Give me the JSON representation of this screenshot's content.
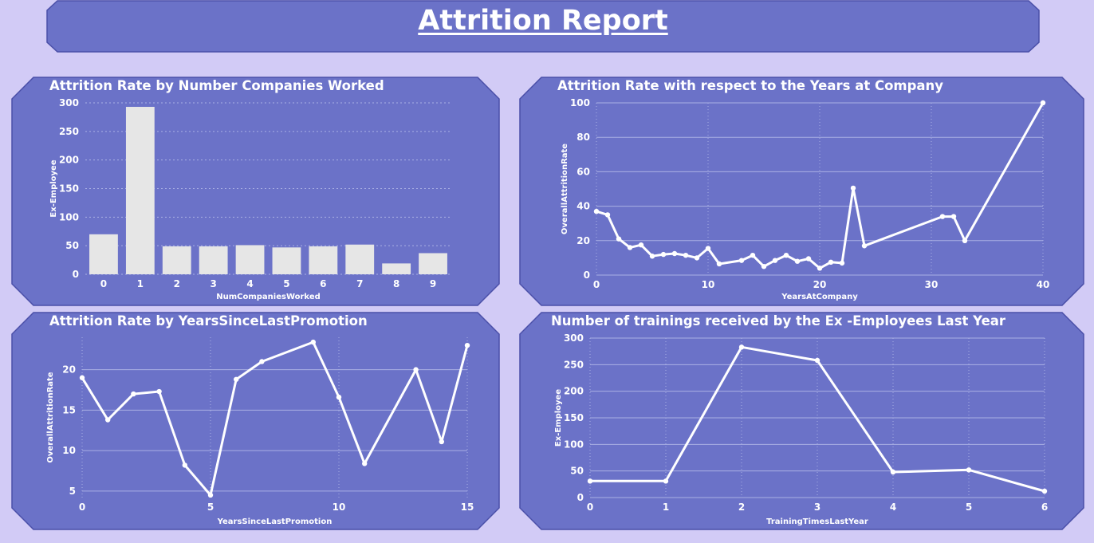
{
  "report": {
    "title": "Attrition Report"
  },
  "colors": {
    "background": "#d2cbf6",
    "panel": "#6b72c8",
    "panel_border": "#4a4fa8",
    "bar": "#e6e6e6",
    "line": "#ffffff",
    "grid": "#aab0e4"
  },
  "chart_data": [
    {
      "type": "bar",
      "title": "Attrition Rate by Number Companies Worked",
      "xlabel": "NumCompaniesWorked",
      "ylabel": "Ex-Employee",
      "categories": [
        "0",
        "1",
        "2",
        "3",
        "4",
        "5",
        "6",
        "7",
        "8",
        "9"
      ],
      "values": [
        70,
        293,
        49,
        49,
        51,
        47,
        49,
        52,
        19,
        37
      ],
      "ylim": [
        0,
        300
      ],
      "yticks": [
        0,
        50,
        100,
        150,
        200,
        250,
        300
      ],
      "grid": true
    },
    {
      "type": "line",
      "title": "Attrition Rate with respect to the Years at Company",
      "xlabel": "YearsAtCompany",
      "ylabel": "OverallAttritionRate",
      "x": [
        0,
        1,
        2,
        3,
        4,
        5,
        6,
        7,
        8,
        9,
        10,
        11,
        13,
        14,
        15,
        16,
        17,
        18,
        19,
        20,
        21,
        22,
        23,
        24,
        31,
        32,
        33,
        40
      ],
      "y": [
        37,
        35,
        21,
        16,
        17.5,
        11,
        12,
        12.5,
        11.5,
        10,
        15.5,
        6.5,
        8.5,
        11.5,
        5,
        8.5,
        11.5,
        8,
        9.5,
        4,
        7.5,
        7,
        50.5,
        17,
        34,
        34,
        20,
        100
      ],
      "xlim": [
        0,
        40
      ],
      "ylim": [
        0,
        100
      ],
      "xticks": [
        0,
        10,
        20,
        30,
        40
      ],
      "yticks": [
        0,
        20,
        40,
        60,
        80,
        100
      ],
      "grid": true
    },
    {
      "type": "line",
      "title": "Attrition Rate by YearsSinceLastPromotion",
      "xlabel": "YearsSinceLastPromotion",
      "ylabel": "OverallAttritionRate",
      "x": [
        0,
        1,
        2,
        3,
        4,
        5,
        6,
        7,
        9,
        10,
        11,
        13,
        14,
        15
      ],
      "y": [
        19,
        13.8,
        17,
        17.3,
        8.2,
        4.5,
        18.8,
        21,
        23.4,
        16.6,
        8.4,
        20,
        11.1,
        23
      ],
      "xlim": [
        0,
        15
      ],
      "ylim": [
        4.2,
        24
      ],
      "xticks": [
        0,
        5,
        10,
        15
      ],
      "yticks": [
        5,
        10,
        15,
        20
      ],
      "grid": true
    },
    {
      "type": "line",
      "title": "Number of trainings received by the Ex -Employees Last Year",
      "xlabel": "TrainingTimesLastYear",
      "ylabel": "Ex-Employee",
      "x": [
        0,
        1,
        2,
        3,
        4,
        5,
        6
      ],
      "y": [
        31,
        31,
        283,
        258,
        48,
        52,
        12
      ],
      "xlim": [
        0,
        6
      ],
      "ylim": [
        0,
        300
      ],
      "xticks": [
        0,
        1,
        2,
        3,
        4,
        5,
        6
      ],
      "yticks": [
        0,
        50,
        100,
        150,
        200,
        250,
        300
      ],
      "grid": true
    }
  ]
}
